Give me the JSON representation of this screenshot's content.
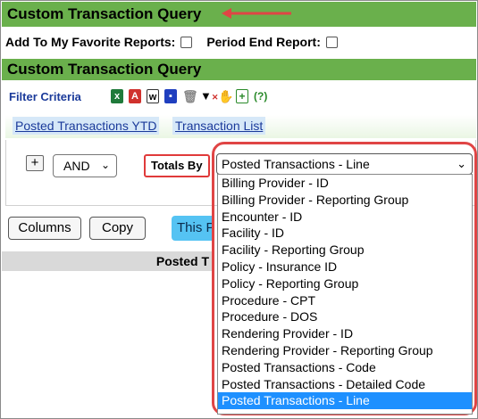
{
  "page_title": "Custom Transaction Query",
  "options": {
    "favorite_label": "Add To My Favorite Reports:",
    "period_end_label": "Period End Report:"
  },
  "section_title": "Custom Transaction Query",
  "filter_label": "Filter Criteria",
  "toolbar": {
    "help_label": "(?)",
    "icons": [
      "excel-icon",
      "pdf-icon",
      "word-icon",
      "save-icon",
      "delete-icon",
      "clear-filter-icon",
      "hand-icon",
      "add-icon",
      "help-icon"
    ]
  },
  "tabs": [
    {
      "label": "Posted Transactions YTD"
    },
    {
      "label": "Transaction List"
    }
  ],
  "criteria": {
    "plus_label": "+",
    "and_value": "AND",
    "totals_by_label": "Totals By",
    "selected_value": "Posted Transactions - Line"
  },
  "dropdown_options": [
    "Billing Provider - ID",
    "Billing Provider - Reporting Group",
    "Encounter - ID",
    "Facility - ID",
    "Facility - Reporting Group",
    "Policy - Insurance ID",
    "Policy - Reporting Group",
    "Procedure - CPT",
    "Procedure - DOS",
    "Rendering Provider - ID",
    "Rendering Provider - Reporting Group",
    "Posted Transactions - Code",
    "Posted Transactions - Detailed Code",
    "Posted Transactions - Line"
  ],
  "buttons": {
    "columns_label": "Columns",
    "copy_label": "Copy",
    "this_label": "This P"
  },
  "table_header": "Posted T",
  "colors": {
    "header_green": "#6ab04c",
    "highlight_red": "#e04545",
    "selected_blue": "#1e90ff",
    "this_button_blue": "#55c3f3"
  }
}
